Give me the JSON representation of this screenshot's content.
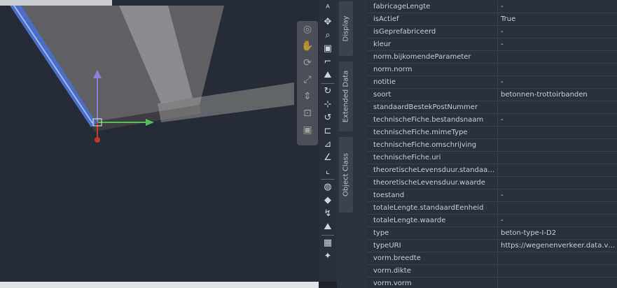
{
  "tabs": [
    {
      "label": "Display"
    },
    {
      "label": "Extended Data"
    },
    {
      "label": "Object Class"
    }
  ],
  "tool_icons": [
    "text-a-icon",
    "move-icon",
    "zoom-icon",
    "image-icon",
    "pointer-icon",
    "stairs-icon",
    "rotate-icon",
    "snap-icon",
    "rotate-back-icon",
    "align-icon",
    "dimension-icon",
    "angle-icon",
    "corner-icon",
    "sphere-icon",
    "fill-icon",
    "curve-icon",
    "stairs-2-icon",
    "grid-icon",
    "star-icon"
  ],
  "properties": [
    {
      "key": "fabricageLengte",
      "value": "-"
    },
    {
      "key": "isActief",
      "value": "True"
    },
    {
      "key": "isGeprefabriceerd",
      "value": "-"
    },
    {
      "key": "kleur",
      "value": "-"
    },
    {
      "key": "norm.bijkomendeParameter",
      "value": ""
    },
    {
      "key": "norm.norm",
      "value": ""
    },
    {
      "key": "notitie",
      "value": "-"
    },
    {
      "key": "soort",
      "value": "betonnen-trottoirbanden"
    },
    {
      "key": "standaardBestekPostNummer",
      "value": ""
    },
    {
      "key": "technischeFiche.bestandsnaam",
      "value": "-"
    },
    {
      "key": "technischeFiche.mimeType",
      "value": ""
    },
    {
      "key": "technischeFiche.omschrijving",
      "value": ""
    },
    {
      "key": "technischeFiche.uri",
      "value": ""
    },
    {
      "key": "theoretischeLevensduur.standaardE...",
      "value": ""
    },
    {
      "key": "theoretischeLevensduur.waarde",
      "value": ""
    },
    {
      "key": "toestand",
      "value": "-"
    },
    {
      "key": "totaleLengte.standaardEenheid",
      "value": ""
    },
    {
      "key": "totaleLengte.waarde",
      "value": "-"
    },
    {
      "key": "type",
      "value": "beton-type-I-D2"
    },
    {
      "key": "typeURI",
      "value": "https://wegenenverkeer.data.vlaa..."
    },
    {
      "key": "vorm.breedte",
      "value": ""
    },
    {
      "key": "vorm.dikte",
      "value": ""
    },
    {
      "key": "vorm.vorm",
      "value": ""
    }
  ]
}
